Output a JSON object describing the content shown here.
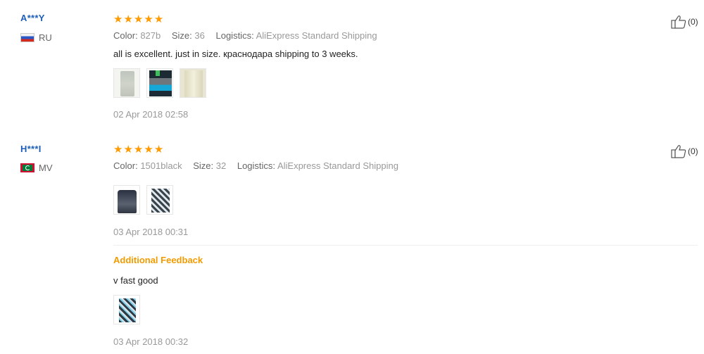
{
  "reviews": [
    {
      "user": "A***Y",
      "country": "RU",
      "stars": 5,
      "color_label": "Color:",
      "color_value": "827b",
      "size_label": "Size:",
      "size_value": "36",
      "logistics_label": "Logistics:",
      "logistics_value": "AliExpress Standard Shipping",
      "text": "all is excellent. just in size. краснодара shipping to 3 weeks.",
      "photos": [
        "photo-1",
        "photo-2",
        "photo-3"
      ],
      "date": "02 Apr 2018 02:58",
      "likes": "(0)"
    },
    {
      "user": "H***I",
      "country": "MV",
      "stars": 5,
      "color_label": "Color:",
      "color_value": "1501black",
      "size_label": "Size:",
      "size_value": "32",
      "logistics_label": "Logistics:",
      "logistics_value": "AliExpress Standard Shipping",
      "photos": [
        "photo-1",
        "photo-2"
      ],
      "date": "03 Apr 2018 00:31",
      "likes": "(0)",
      "additional": {
        "title": "Additional Feedback",
        "text": "v fast good",
        "photos": [
          "photo-1"
        ],
        "date": "03 Apr 2018 00:32"
      }
    }
  ],
  "icons": {
    "star": "star-icon",
    "like": "thumbs-up-icon",
    "flag_ru": "russia-flag-icon",
    "flag_mv": "maldives-flag-icon"
  },
  "colors": {
    "star": "#ff9a00",
    "username": "#1d5fb8",
    "additional_title": "#f29b00"
  }
}
